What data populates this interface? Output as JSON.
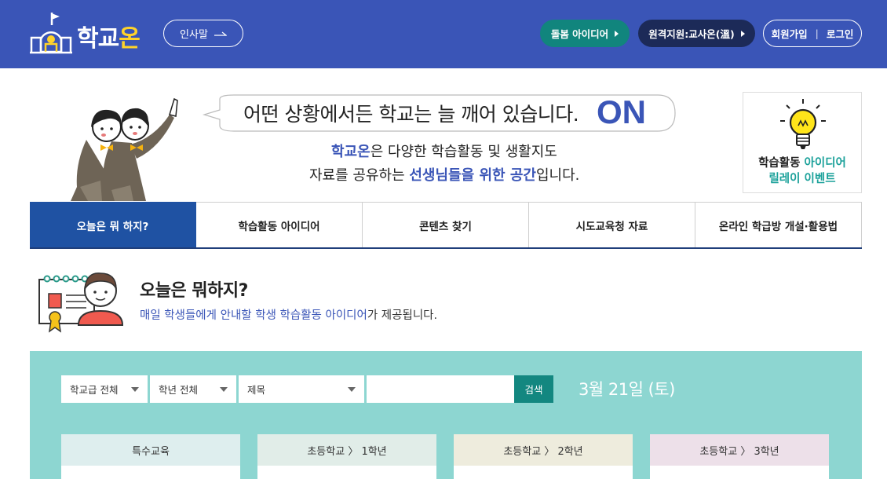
{
  "header": {
    "logo": {
      "text_main": "학교",
      "text_accent": "온"
    },
    "greeting_label": "인사말",
    "care_label": "돌봄 아이디어",
    "remote_label": "원격지원:교사온(溫)",
    "signup_label": "회원가입",
    "separator": "|",
    "login_label": "로그인",
    "colors": {
      "header_bg": "#3a55b7",
      "care_bg": "#11857d",
      "remote_bg": "#1c2a58",
      "accent_yellow": "#ffd32a"
    }
  },
  "hero": {
    "bubble_text": "어떤 상황에서든 학교는 늘 깨어 있습니다.",
    "bubble_on": "ON",
    "desc1_highlight": "학교온",
    "desc1_rest": "은 다양한 학습활동 및 생활지도",
    "desc2_pre": "자료를 공유하는 ",
    "desc2_highlight": "선생님들을 위한 공간",
    "desc2_post": "입니다."
  },
  "event": {
    "line1_a": "학습활동 ",
    "line1_b": "아이디어",
    "line2": "릴레이 이벤트",
    "icon": "lightbulb-icon"
  },
  "tabs": [
    {
      "label": "오늘은 뭐 하지?",
      "active": true
    },
    {
      "label": "학습활동 아이디어",
      "active": false
    },
    {
      "label": "콘텐츠 찾기",
      "active": false
    },
    {
      "label": "시도교육청 자료",
      "active": false
    },
    {
      "label": "온라인 학급방 개설·활용법",
      "active": false
    }
  ],
  "section": {
    "title": "오늘은 뭐하지?",
    "sub_blue": "매일 학생들에게 안내할 학생 학습활동 아이디어",
    "sub_rest": "가 제공됩니다."
  },
  "search": {
    "school_level": "학교급 전체",
    "grade": "학년 전체",
    "field": "제목",
    "query": "",
    "button": "검색",
    "date": "3월 21일 (토)",
    "colors": {
      "panel_bg": "#8dd6d1",
      "button_bg": "#138780"
    }
  },
  "cards": [
    {
      "label": "특수교육"
    },
    {
      "label": "초등학교 〉 1학년"
    },
    {
      "label": "초등학교 〉 2학년"
    },
    {
      "label": "초등학교 〉 3학년"
    }
  ]
}
